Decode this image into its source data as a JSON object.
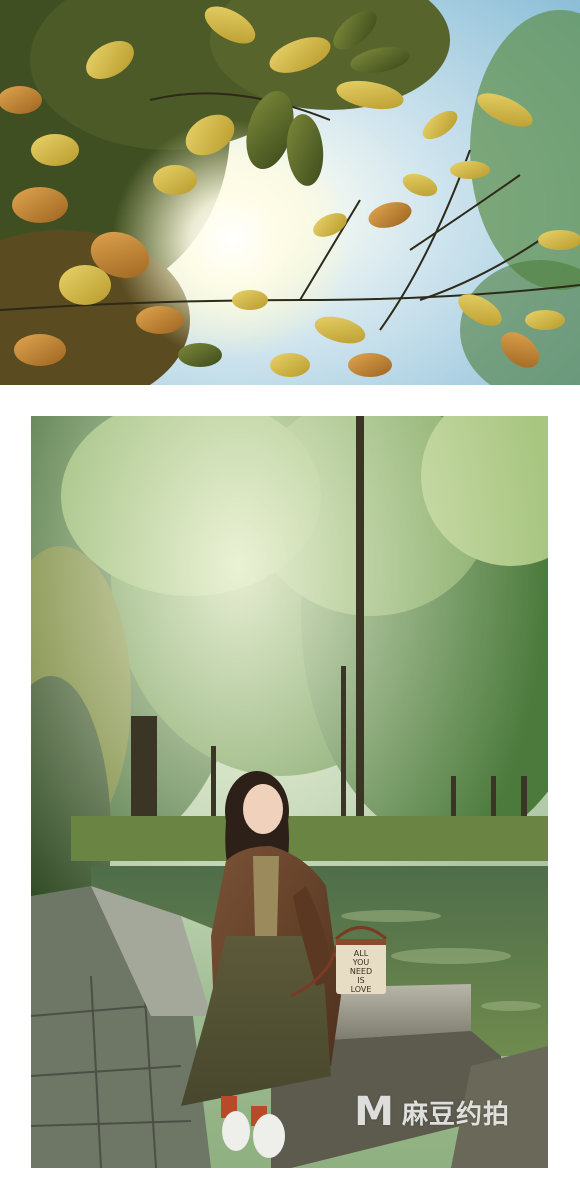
{
  "photos": [
    {
      "id": "top",
      "subject": "sunlight through autumn leaves"
    },
    {
      "id": "bottom",
      "subject": "woman sitting on stone by pond in forest"
    }
  ],
  "bag_text": {
    "line1": "ALL",
    "line2": "YOU",
    "line3": "NEED",
    "line4": "IS",
    "line5": "LOVE"
  },
  "watermark": {
    "logo": "M",
    "text": "麻豆约拍"
  }
}
